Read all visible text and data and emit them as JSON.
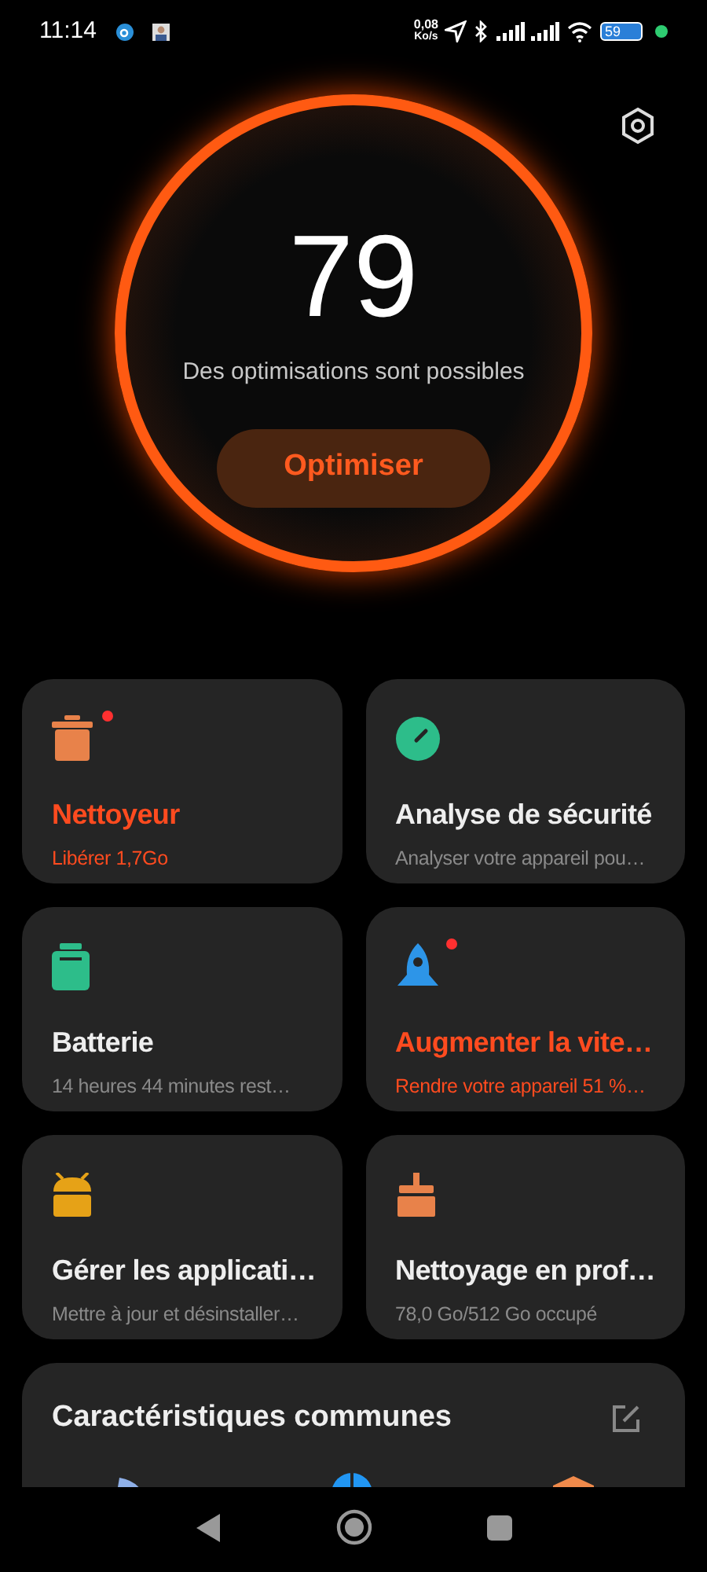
{
  "status_bar": {
    "time": "11:14",
    "speed_value": "0,08",
    "speed_unit": "Ko/s",
    "battery": "59"
  },
  "score": {
    "value": "79",
    "message": "Des optimisations sont possibles",
    "button": "Optimiser"
  },
  "tiles": [
    {
      "kind": "cleaner",
      "title": "Nettoyeur",
      "subtitle": "Libérer 1,7Go",
      "alert": true,
      "highlighted": true
    },
    {
      "kind": "security",
      "title": "Analyse de sécurité",
      "subtitle": "Analyser votre appareil pou…",
      "alert": false,
      "highlighted": false
    },
    {
      "kind": "battery",
      "title": "Batterie",
      "subtitle": "14 heures 44 minutes  rest…",
      "alert": false,
      "highlighted": false
    },
    {
      "kind": "boost",
      "title": "Augmenter la vite…",
      "subtitle": "Rendre votre appareil 51 %…",
      "alert": true,
      "highlighted": true
    },
    {
      "kind": "apps",
      "title": "Gérer les applicati…",
      "subtitle": "Mettre à jour et désinstaller…",
      "alert": false,
      "highlighted": false
    },
    {
      "kind": "deepclean",
      "title": "Nettoyage en prof…",
      "subtitle": "78,0 Go/512 Go occupé",
      "alert": false,
      "highlighted": false
    }
  ],
  "common_features": {
    "title": "Caractéristiques communes"
  }
}
